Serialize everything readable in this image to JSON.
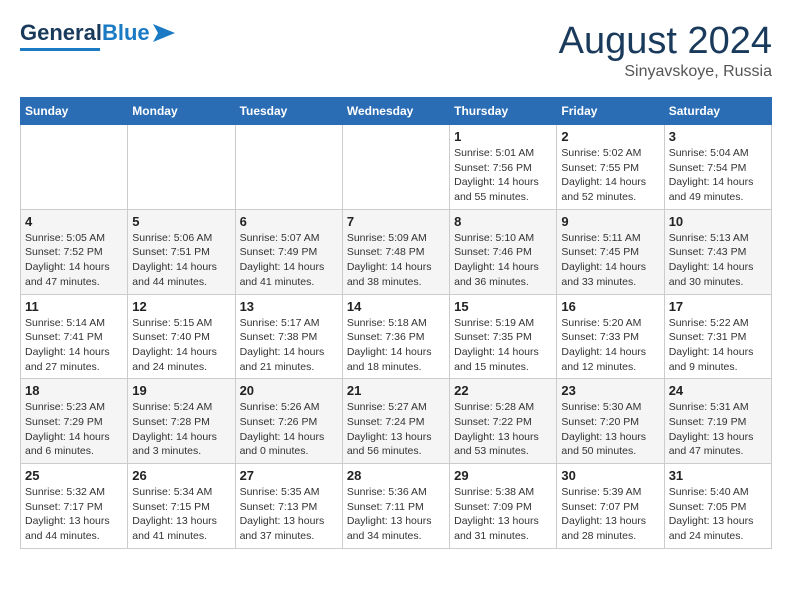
{
  "logo": {
    "part1": "General",
    "part2": "Blue"
  },
  "header": {
    "month_year": "August 2024",
    "location": "Sinyavskoye, Russia"
  },
  "weekdays": [
    "Sunday",
    "Monday",
    "Tuesday",
    "Wednesday",
    "Thursday",
    "Friday",
    "Saturday"
  ],
  "weeks": [
    [
      {
        "day": "",
        "info": ""
      },
      {
        "day": "",
        "info": ""
      },
      {
        "day": "",
        "info": ""
      },
      {
        "day": "",
        "info": ""
      },
      {
        "day": "1",
        "info": "Sunrise: 5:01 AM\nSunset: 7:56 PM\nDaylight: 14 hours\nand 55 minutes."
      },
      {
        "day": "2",
        "info": "Sunrise: 5:02 AM\nSunset: 7:55 PM\nDaylight: 14 hours\nand 52 minutes."
      },
      {
        "day": "3",
        "info": "Sunrise: 5:04 AM\nSunset: 7:54 PM\nDaylight: 14 hours\nand 49 minutes."
      }
    ],
    [
      {
        "day": "4",
        "info": "Sunrise: 5:05 AM\nSunset: 7:52 PM\nDaylight: 14 hours\nand 47 minutes."
      },
      {
        "day": "5",
        "info": "Sunrise: 5:06 AM\nSunset: 7:51 PM\nDaylight: 14 hours\nand 44 minutes."
      },
      {
        "day": "6",
        "info": "Sunrise: 5:07 AM\nSunset: 7:49 PM\nDaylight: 14 hours\nand 41 minutes."
      },
      {
        "day": "7",
        "info": "Sunrise: 5:09 AM\nSunset: 7:48 PM\nDaylight: 14 hours\nand 38 minutes."
      },
      {
        "day": "8",
        "info": "Sunrise: 5:10 AM\nSunset: 7:46 PM\nDaylight: 14 hours\nand 36 minutes."
      },
      {
        "day": "9",
        "info": "Sunrise: 5:11 AM\nSunset: 7:45 PM\nDaylight: 14 hours\nand 33 minutes."
      },
      {
        "day": "10",
        "info": "Sunrise: 5:13 AM\nSunset: 7:43 PM\nDaylight: 14 hours\nand 30 minutes."
      }
    ],
    [
      {
        "day": "11",
        "info": "Sunrise: 5:14 AM\nSunset: 7:41 PM\nDaylight: 14 hours\nand 27 minutes."
      },
      {
        "day": "12",
        "info": "Sunrise: 5:15 AM\nSunset: 7:40 PM\nDaylight: 14 hours\nand 24 minutes."
      },
      {
        "day": "13",
        "info": "Sunrise: 5:17 AM\nSunset: 7:38 PM\nDaylight: 14 hours\nand 21 minutes."
      },
      {
        "day": "14",
        "info": "Sunrise: 5:18 AM\nSunset: 7:36 PM\nDaylight: 14 hours\nand 18 minutes."
      },
      {
        "day": "15",
        "info": "Sunrise: 5:19 AM\nSunset: 7:35 PM\nDaylight: 14 hours\nand 15 minutes."
      },
      {
        "day": "16",
        "info": "Sunrise: 5:20 AM\nSunset: 7:33 PM\nDaylight: 14 hours\nand 12 minutes."
      },
      {
        "day": "17",
        "info": "Sunrise: 5:22 AM\nSunset: 7:31 PM\nDaylight: 14 hours\nand 9 minutes."
      }
    ],
    [
      {
        "day": "18",
        "info": "Sunrise: 5:23 AM\nSunset: 7:29 PM\nDaylight: 14 hours\nand 6 minutes."
      },
      {
        "day": "19",
        "info": "Sunrise: 5:24 AM\nSunset: 7:28 PM\nDaylight: 14 hours\nand 3 minutes."
      },
      {
        "day": "20",
        "info": "Sunrise: 5:26 AM\nSunset: 7:26 PM\nDaylight: 14 hours\nand 0 minutes."
      },
      {
        "day": "21",
        "info": "Sunrise: 5:27 AM\nSunset: 7:24 PM\nDaylight: 13 hours\nand 56 minutes."
      },
      {
        "day": "22",
        "info": "Sunrise: 5:28 AM\nSunset: 7:22 PM\nDaylight: 13 hours\nand 53 minutes."
      },
      {
        "day": "23",
        "info": "Sunrise: 5:30 AM\nSunset: 7:20 PM\nDaylight: 13 hours\nand 50 minutes."
      },
      {
        "day": "24",
        "info": "Sunrise: 5:31 AM\nSunset: 7:19 PM\nDaylight: 13 hours\nand 47 minutes."
      }
    ],
    [
      {
        "day": "25",
        "info": "Sunrise: 5:32 AM\nSunset: 7:17 PM\nDaylight: 13 hours\nand 44 minutes."
      },
      {
        "day": "26",
        "info": "Sunrise: 5:34 AM\nSunset: 7:15 PM\nDaylight: 13 hours\nand 41 minutes."
      },
      {
        "day": "27",
        "info": "Sunrise: 5:35 AM\nSunset: 7:13 PM\nDaylight: 13 hours\nand 37 minutes."
      },
      {
        "day": "28",
        "info": "Sunrise: 5:36 AM\nSunset: 7:11 PM\nDaylight: 13 hours\nand 34 minutes."
      },
      {
        "day": "29",
        "info": "Sunrise: 5:38 AM\nSunset: 7:09 PM\nDaylight: 13 hours\nand 31 minutes."
      },
      {
        "day": "30",
        "info": "Sunrise: 5:39 AM\nSunset: 7:07 PM\nDaylight: 13 hours\nand 28 minutes."
      },
      {
        "day": "31",
        "info": "Sunrise: 5:40 AM\nSunset: 7:05 PM\nDaylight: 13 hours\nand 24 minutes."
      }
    ]
  ]
}
